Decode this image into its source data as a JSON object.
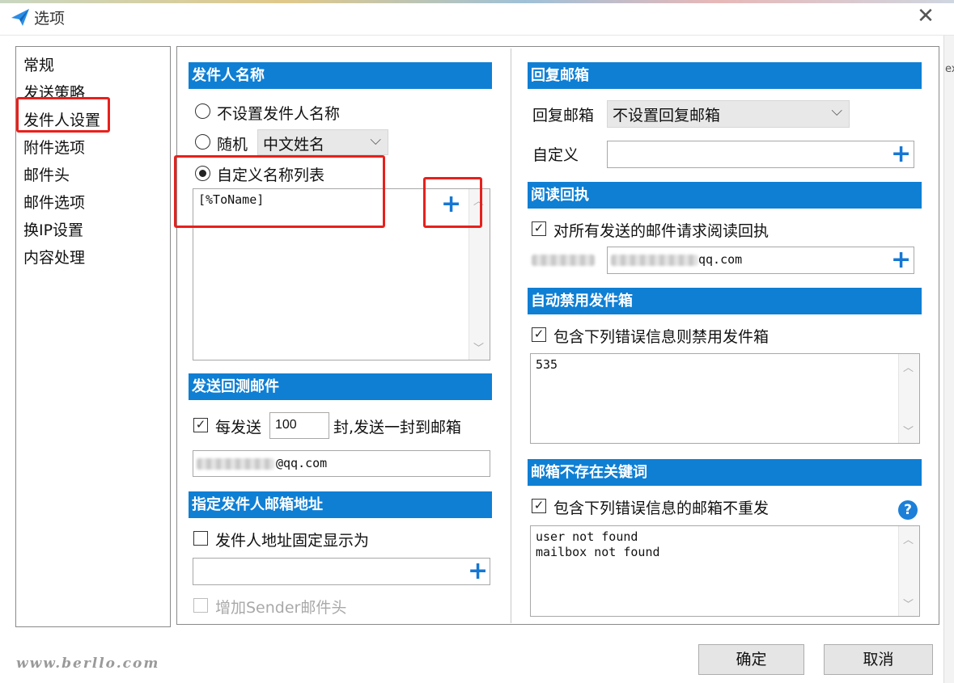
{
  "window": {
    "title": "选项",
    "right_edge_text": "ex"
  },
  "nav": {
    "items": [
      "常规",
      "发送策略",
      "发件人设置",
      "附件选项",
      "邮件头",
      "邮件选项",
      "换IP设置",
      "内容处理"
    ],
    "selected_index": 2
  },
  "sender_name": {
    "header": "发件人名称",
    "option_none": "不设置发件人名称",
    "option_random": "随机",
    "random_select_value": "中文姓名",
    "option_custom": "自定义名称列表",
    "selected": "custom",
    "list_value": "[%ToName]"
  },
  "test_mail": {
    "header": "发送回测邮件",
    "checked": true,
    "prefix": "每发送",
    "count": "100",
    "suffix": "封,发送一封到邮箱",
    "address": "@qq.com"
  },
  "sender_address": {
    "header": "指定发件人邮箱地址",
    "fixed_label": "发件人地址固定显示为",
    "fixed_checked": false,
    "fixed_value": "",
    "add_sender_label": "增加Sender邮件头",
    "add_sender_checked": false
  },
  "reply": {
    "header": "回复邮箱",
    "reply_label": "回复邮箱",
    "reply_select_value": "不设置回复邮箱",
    "custom_label": "自定义",
    "custom_value": ""
  },
  "read_receipt": {
    "header": "阅读回执",
    "label": "对所有发送的邮件请求阅读回执",
    "checked": true,
    "address": "qq.com"
  },
  "auto_disable": {
    "header": "自动禁用发件箱",
    "label": "包含下列错误信息则禁用发件箱",
    "checked": true,
    "errors": "535"
  },
  "nonexistent": {
    "header": "邮箱不存在关键词",
    "label": "包含下列错误信息的邮箱不重发",
    "checked": true,
    "keywords": "user not found\nmailbox not found"
  },
  "buttons": {
    "ok": "确定",
    "cancel": "取消"
  },
  "watermark": "www.berllo.com",
  "icons": {
    "close": "close-icon",
    "plus": "plus-icon",
    "help": "help-icon",
    "chevron": "chevron-down-icon",
    "app": "paper-plane-icon"
  },
  "colors": {
    "section_header": "#0f7fd4",
    "highlight": "#e8201c",
    "plus": "#1577d3"
  }
}
